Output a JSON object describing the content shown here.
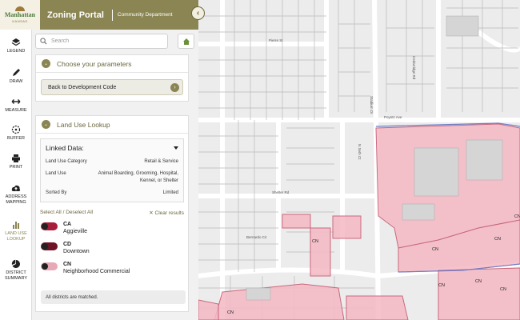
{
  "header": {
    "logo_text": "Manhattan",
    "logo_sub": "KANSAS",
    "app_title": "Zoning Portal",
    "department": "Community Department",
    "collapse_icon": "chevron-left-icon"
  },
  "toolbar": {
    "tools": [
      {
        "id": "legend",
        "label": "LEGEND",
        "icon": "layers-icon"
      },
      {
        "id": "draw",
        "label": "DRAW",
        "icon": "pencil-icon"
      },
      {
        "id": "measure",
        "label": "MEASURE",
        "icon": "ruler-icon"
      },
      {
        "id": "buffer",
        "label": "BUFFER",
        "icon": "buffer-icon"
      },
      {
        "id": "print",
        "label": "PRINT",
        "icon": "printer-icon"
      },
      {
        "id": "address",
        "label": "ADDRESS MAPPING",
        "icon": "upload-cloud-icon"
      },
      {
        "id": "landuse",
        "label": "LAND USE LOOKUP",
        "icon": "bar-chart-icon",
        "active": true
      },
      {
        "id": "district",
        "label": "DISTRICT SUMMARY",
        "icon": "pie-chart-icon"
      }
    ]
  },
  "search": {
    "placeholder": "Search"
  },
  "parameters": {
    "title": "Choose your parameters",
    "back_button": "Back to Development Code"
  },
  "landuse": {
    "title": "Land Use Lookup",
    "linked_title": "Linked Data:",
    "rows": [
      {
        "key": "Land Use Category",
        "value": "Retail & Service"
      },
      {
        "key": "Land Use",
        "value": "Animal Boarding, Grooming, Hospital, Kennel, or Shelter"
      },
      {
        "key": "Sorted By",
        "value": "Limited"
      }
    ],
    "select_all": "Select All",
    "separator": "/",
    "deselect_all": "Deselect All",
    "clear_results": "✕ Clear results",
    "districts": [
      {
        "code": "CA",
        "name": "Aggieville",
        "color": "#a61e3a"
      },
      {
        "code": "CD",
        "name": "Downtown",
        "color": "#6e1426"
      },
      {
        "code": "CN",
        "name": "Neighborhood Commercial",
        "color": "#e7a9b6"
      }
    ],
    "status": "All districts are matched."
  },
  "map": {
    "street_labels": [
      "Pierre St",
      "Poyntz Ave",
      "Shelter Rd",
      "Bernardo Cir",
      "Cedarridge Rd",
      "Stadium Dr",
      "N Seth Ct"
    ],
    "zone_labels": [
      "CN",
      "CN",
      "CN",
      "CN",
      "CN",
      "CN",
      "CN",
      "CN"
    ],
    "zone_color": "#f4b8c4"
  },
  "colors": {
    "accent": "#8a8552",
    "accent_dark": "#6b673f"
  }
}
